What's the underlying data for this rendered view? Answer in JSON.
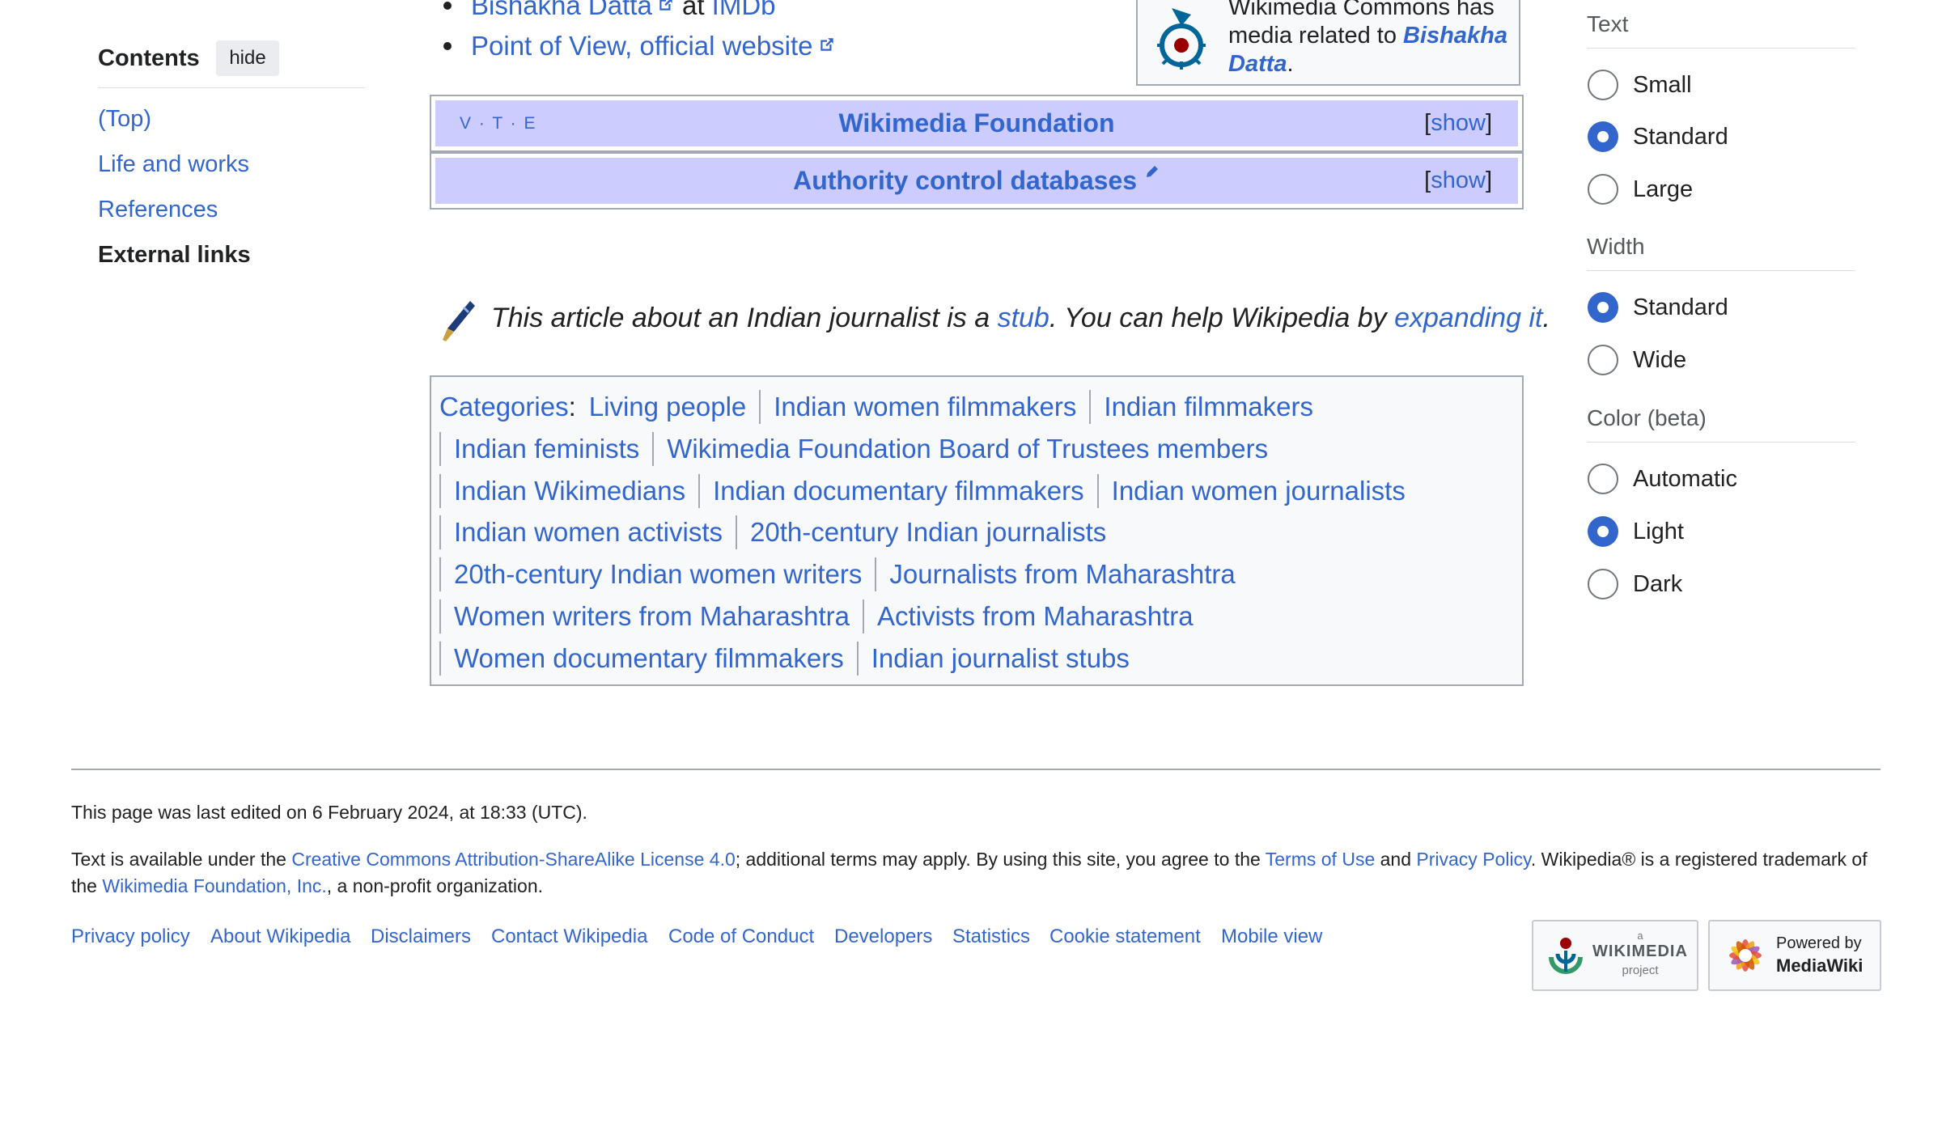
{
  "toc": {
    "title": "Contents",
    "hide": "hide",
    "items": [
      "(Top)",
      "Life and works",
      "References",
      "External links"
    ]
  },
  "external_links": {
    "imdb_name": "Bishakha Datta",
    "imdb_at": " at ",
    "imdb": "IMDb",
    "pov": "Point of View, official website"
  },
  "commons": {
    "text": "Wikimedia Commons has media related to ",
    "subject": "Bishakha Datta",
    "period": "."
  },
  "navboxes": [
    {
      "title": "Wikimedia Foundation",
      "show": "show",
      "vte": [
        "V",
        "T",
        "E"
      ]
    },
    {
      "title": "Authority control databases",
      "show": "show"
    }
  ],
  "stub": {
    "pre": "This article about an Indian journalist is a ",
    "stub": "stub",
    "mid": ". You can help Wikipedia by ",
    "expand": "expanding it",
    "end": "."
  },
  "categories": {
    "label": "Categories",
    "items": [
      "Living people",
      "Indian women filmmakers",
      "Indian filmmakers",
      "Indian feminists",
      "Wikimedia Foundation Board of Trustees members",
      "Indian Wikimedians",
      "Indian documentary filmmakers",
      "Indian women journalists",
      "Indian women activists",
      "20th-century Indian journalists",
      "20th-century Indian women writers",
      "Journalists from Maharashtra",
      "Women writers from Maharashtra",
      "Activists from Maharashtra",
      "Women documentary filmmakers",
      "Indian journalist stubs"
    ]
  },
  "appearance": {
    "text_heading": "Text",
    "text_options": [
      "Small",
      "Standard",
      "Large"
    ],
    "text_selected": "Standard",
    "width_heading": "Width",
    "width_options": [
      "Standard",
      "Wide"
    ],
    "width_selected": "Standard",
    "color_heading": "Color (beta)",
    "color_options": [
      "Automatic",
      "Light",
      "Dark"
    ],
    "color_selected": "Light"
  },
  "footer": {
    "last_edited": "This page was last edited on 6 February 2024, at 18:33 (UTC).",
    "license_pre": "Text is available under the ",
    "license_link": "Creative Commons Attribution-ShareAlike License 4.0",
    "license_mid": "; additional terms may apply. By using this site, you agree to the ",
    "terms": "Terms of Use",
    "and": " and ",
    "privacy": "Privacy Policy",
    "license_post": ". Wikipedia® is a registered trademark of the ",
    "foundation": "Wikimedia Foundation, Inc.",
    "license_end": ", a non-profit organization.",
    "nav": [
      "Privacy policy",
      "About Wikipedia",
      "Disclaimers",
      "Contact Wikipedia",
      "Code of Conduct",
      "Developers",
      "Statistics",
      "Cookie statement",
      "Mobile view"
    ],
    "wikimedia_badge": {
      "small": "a",
      "big": "WIKIMEDIA",
      "sub": "project"
    },
    "mediawiki_badge": {
      "small": "Powered by",
      "big": "MediaWiki"
    }
  },
  "colors": {
    "link": "#3366cc",
    "navbox_title_bg": "#ccccff",
    "border": "#a2a9b1",
    "radio_selected": "#3366cc"
  },
  "icons": [
    "external-link-icon",
    "commons-logo-icon",
    "pencil-icon",
    "fountain-pen-icon",
    "wikimedia-logo-icon",
    "mediawiki-logo-icon"
  ]
}
